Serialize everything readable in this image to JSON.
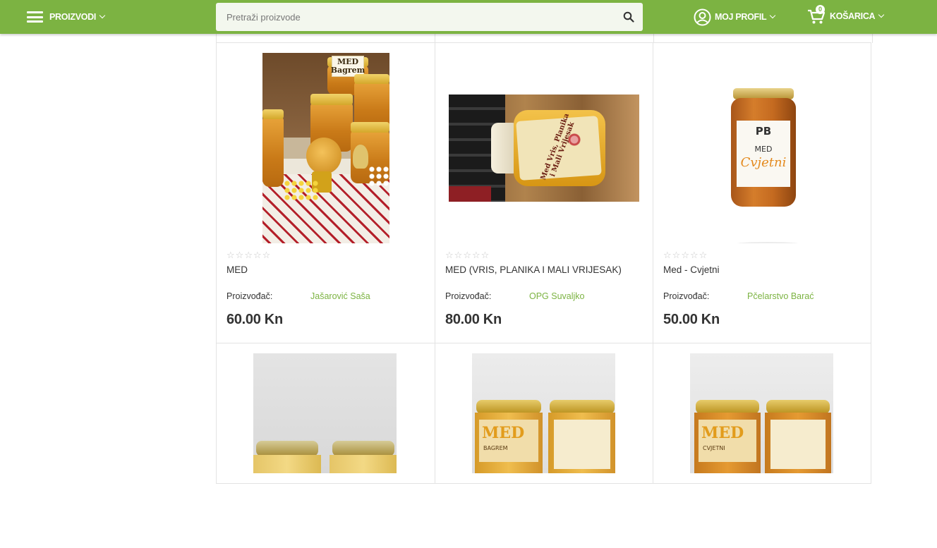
{
  "header": {
    "menu_label": "PROIZVODI",
    "search_placeholder": "Pretraži proizvode",
    "profile_label": "MOJ PROFIL",
    "cart_label": "KOŠARICA",
    "cart_count": "0"
  },
  "colors": {
    "brand_green": "#7cb342",
    "text_dark": "#333333",
    "border": "#e3e3e3"
  },
  "products": [
    {
      "name": "MED",
      "maker_label": "Proizvođač:",
      "maker": "Jašarović Saša",
      "price": "60.00 Kn",
      "rating": 0,
      "image_text": "MED Bagrem"
    },
    {
      "name": "MED (VRIS, PLANIKA I MALI VRIJESAK)",
      "maker_label": "Proizvođač:",
      "maker": "OPG Suvaljko",
      "price": "80.00 Kn",
      "rating": 0,
      "image_text": "Med Vris, Planika i Mali Vrijesak"
    },
    {
      "name": "Med - Cvjetni",
      "maker_label": "Proizvođač:",
      "maker": "Pčelarstvo Barać",
      "price": "50.00 Kn",
      "rating": 0,
      "image_text_1": "PB",
      "image_text_2": "MED",
      "image_text_3": "Cvjetni"
    }
  ],
  "products_row2": [
    {
      "image_text": ""
    },
    {
      "image_text_1": "MED",
      "image_text_2": "BAGREM"
    },
    {
      "image_text_1": "MED",
      "image_text_2": "CVJETNI"
    }
  ]
}
